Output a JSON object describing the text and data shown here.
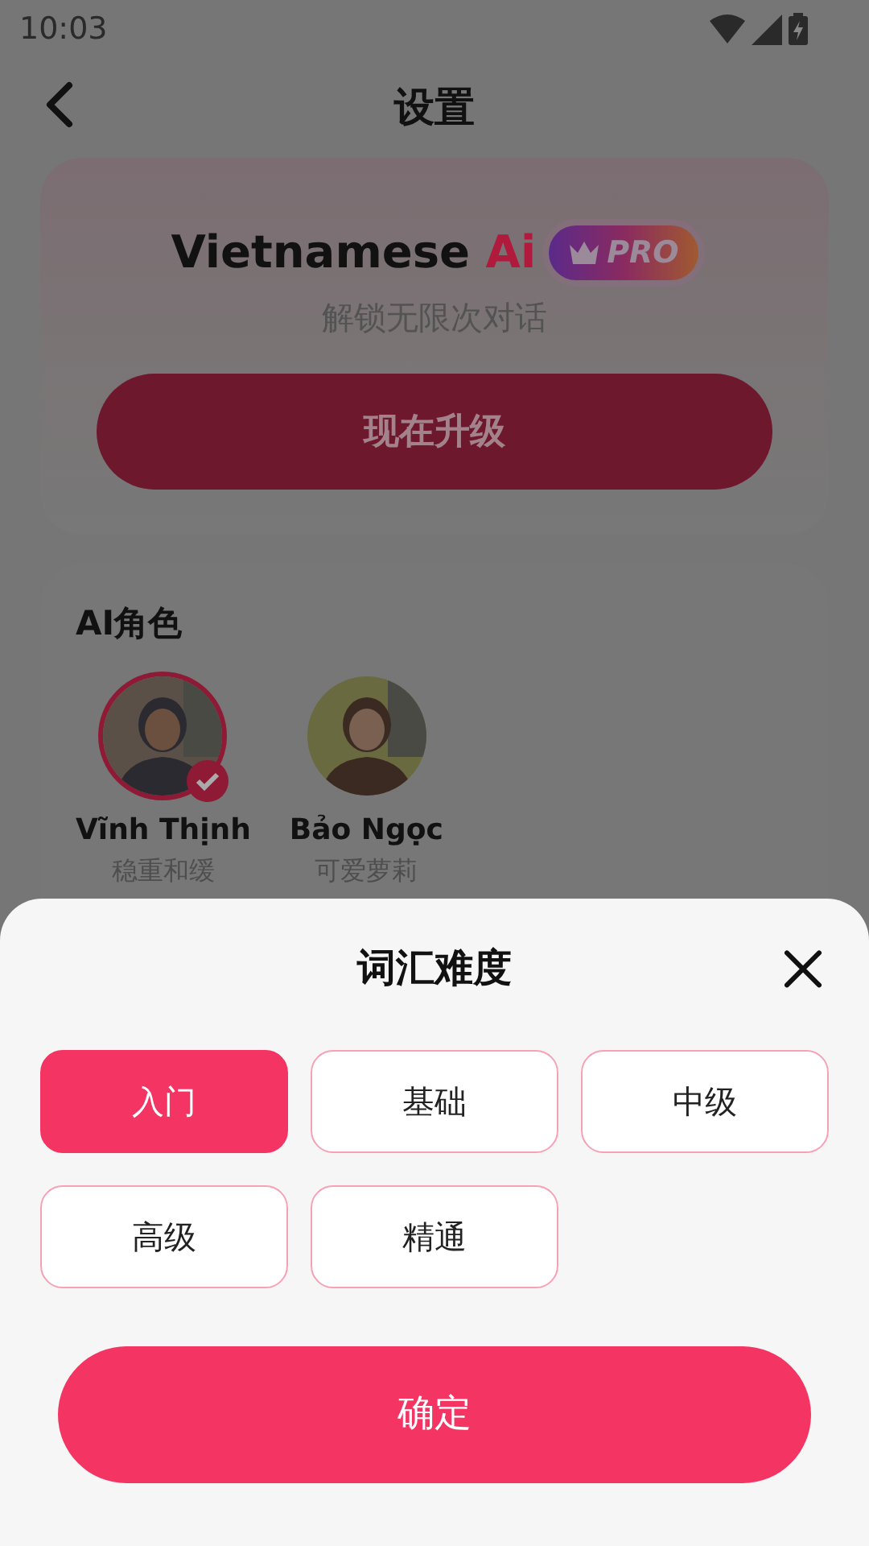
{
  "status_bar": {
    "time": "10:03"
  },
  "header": {
    "title": "设置"
  },
  "pro_card": {
    "title": "Vietnamese",
    "title_accent": "Ai",
    "badge": "PRO",
    "subtitle": "解锁无限次对话",
    "button": "现在升级"
  },
  "characters": {
    "title": "AI角色",
    "items": [
      {
        "name": "Vĩnh Thịnh",
        "description": "稳重和缓",
        "selected": true
      },
      {
        "name": "Bảo Ngọc",
        "description": "可爱萝莉",
        "selected": false
      }
    ]
  },
  "sheet": {
    "title": "词汇难度",
    "options": [
      {
        "label": "入门",
        "selected": true
      },
      {
        "label": "基础",
        "selected": false
      },
      {
        "label": "中级",
        "selected": false
      },
      {
        "label": "高级",
        "selected": false
      },
      {
        "label": "精通",
        "selected": false
      }
    ],
    "confirm": "确定"
  }
}
